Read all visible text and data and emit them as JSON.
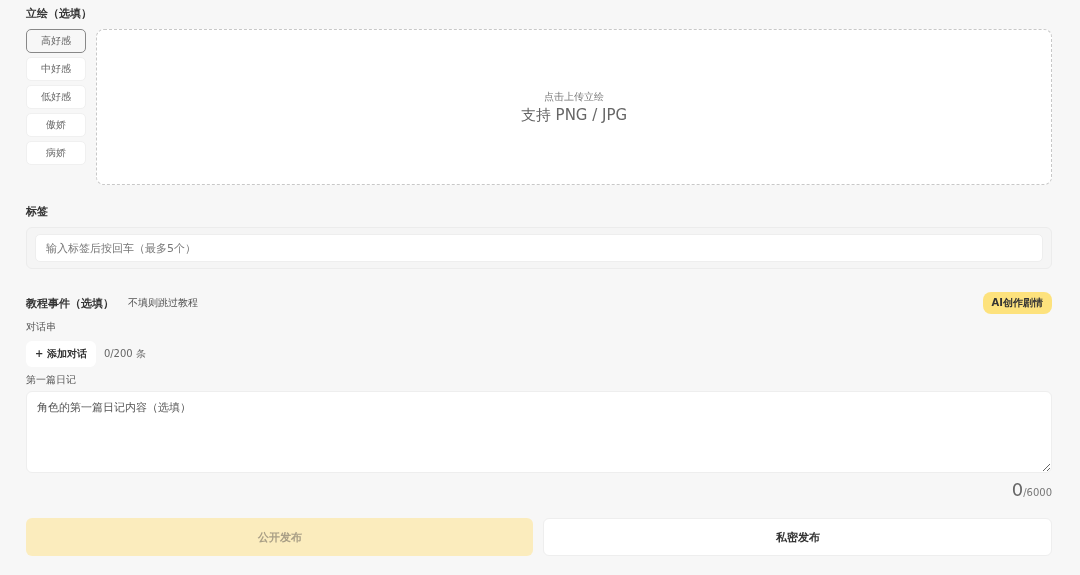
{
  "portrait": {
    "title": "立绘（选填）",
    "moods": [
      {
        "label": "高好感",
        "selected": true
      },
      {
        "label": "中好感",
        "selected": false
      },
      {
        "label": "低好感",
        "selected": false
      },
      {
        "label": "傲娇",
        "selected": false
      },
      {
        "label": "病娇",
        "selected": false
      }
    ],
    "upload": {
      "hint": "点击上传立绘",
      "formats": "支持 PNG / JPG"
    }
  },
  "tags": {
    "title": "标签",
    "placeholder": "输入标签后按回车（最多5个）"
  },
  "tutorial": {
    "title": "教程事件（选填）",
    "note": "不填则跳过教程",
    "ai_button": "AI创作剧情",
    "dialogue_label": "对话串",
    "add_button": "+ 添加对话",
    "dialogue_count": "0/200 条",
    "diary_label": "第一篇日记",
    "diary_placeholder": "角色的第一篇日记内容（选填）",
    "char_count": "0",
    "char_max": "/6000"
  },
  "actions": [
    {
      "label": "公开发布",
      "kind": "primary",
      "disabled": true
    },
    {
      "label": "私密发布",
      "kind": "secondary",
      "disabled": false
    }
  ]
}
